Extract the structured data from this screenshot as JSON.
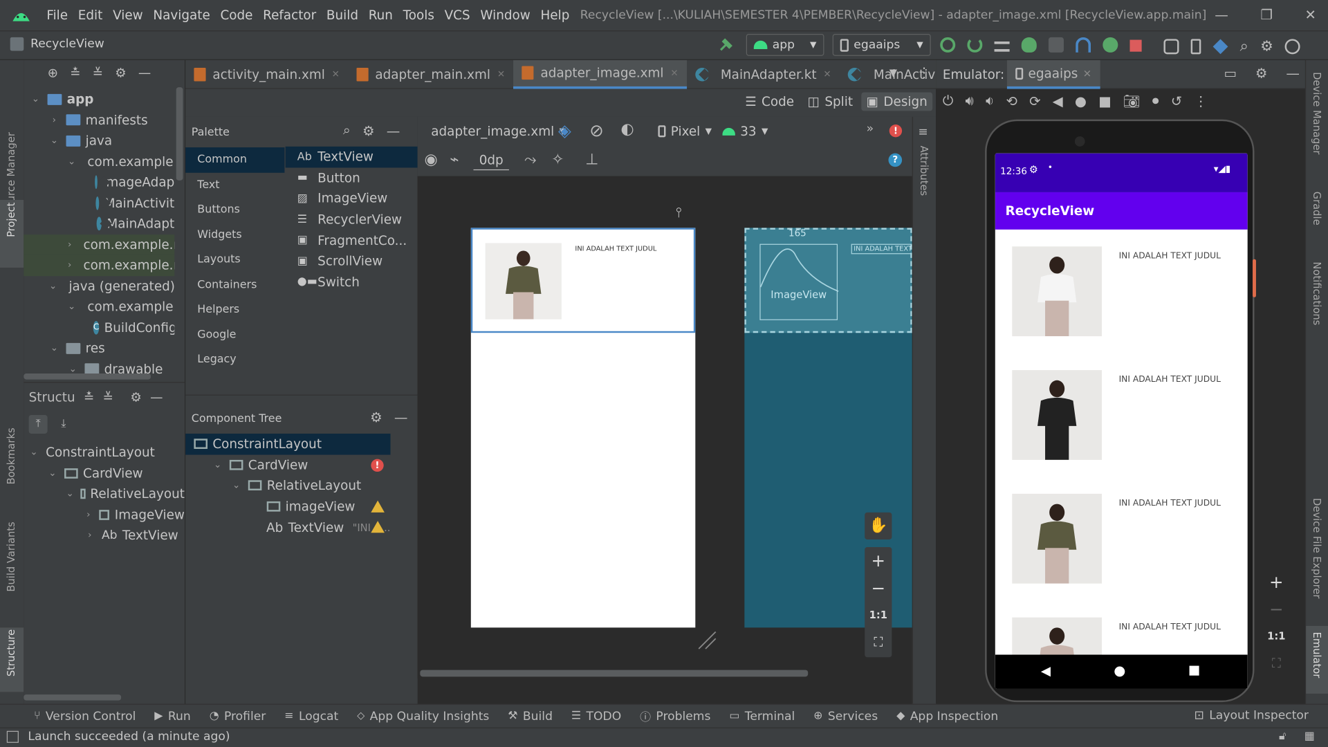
{
  "menu": [
    "File",
    "Edit",
    "View",
    "Navigate",
    "Code",
    "Refactor",
    "Build",
    "Run",
    "Tools",
    "VCS",
    "Window",
    "Help"
  ],
  "window_title": "RecycleView [...\\KULIAH\\SEMESTER 4\\PEMBER\\RecycleView] - adapter_image.xml [RecycleView.app.main]",
  "project_name": "RecycleView",
  "run_config": "app",
  "device_config": "egaaips",
  "left_strip": {
    "resource_manager": "Resource Manager",
    "project": "Project",
    "bookmarks": "Bookmarks",
    "build_variants": "Build Variants",
    "structure": "Structure"
  },
  "right_strip": {
    "device_manager": "Device Manager",
    "gradle": "Gradle",
    "notifications": "Notifications",
    "device_file_explorer": "Device File Explorer",
    "emulator": "Emulator"
  },
  "project_tree": [
    {
      "label": "app",
      "indent": 0,
      "chev": "v",
      "icon": "folder-blue",
      "bold": true
    },
    {
      "label": "manifests",
      "indent": 1,
      "chev": ">",
      "icon": "folder-blue"
    },
    {
      "label": "java",
      "indent": 1,
      "chev": "v",
      "icon": "folder-blue"
    },
    {
      "label": "com.example.r",
      "indent": 2,
      "chev": "v",
      "icon": "folder"
    },
    {
      "label": "ImageAdap",
      "indent": 3,
      "chev": "",
      "icon": "kotlin"
    },
    {
      "label": "MainActivit",
      "indent": 3,
      "chev": "",
      "icon": "kotlin"
    },
    {
      "label": "MainAdapt",
      "indent": 3,
      "chev": "",
      "icon": "kotlin"
    },
    {
      "label": "com.example.r",
      "indent": 2,
      "chev": ">",
      "icon": "folder",
      "hl": true
    },
    {
      "label": "com.example.r",
      "indent": 2,
      "chev": ">",
      "icon": "folder",
      "hl": true
    },
    {
      "label": "java (generated)",
      "indent": 1,
      "chev": "v",
      "icon": "folder"
    },
    {
      "label": "com.example.r",
      "indent": 2,
      "chev": "v",
      "icon": "folder"
    },
    {
      "label": "BuildConfig",
      "indent": 3,
      "chev": "",
      "icon": "class"
    },
    {
      "label": "res",
      "indent": 1,
      "chev": "v",
      "icon": "folder"
    },
    {
      "label": "drawable",
      "indent": 2,
      "chev": "v",
      "icon": "folder"
    }
  ],
  "structure_title": "Structu",
  "structure_tree": [
    {
      "label": "ConstraintLayout",
      "indent": 0,
      "chev": "v"
    },
    {
      "label": "CardView",
      "indent": 1,
      "chev": "v"
    },
    {
      "label": "RelativeLayout",
      "indent": 2,
      "chev": "v"
    },
    {
      "label": "ImageView",
      "indent": 3,
      "chev": ">"
    },
    {
      "label": "TextView",
      "indent": 3,
      "chev": ">",
      "prefix": "Ab"
    }
  ],
  "editor_tabs": [
    {
      "label": "activity_main.xml",
      "icon": "xml"
    },
    {
      "label": "adapter_main.xml",
      "icon": "xml"
    },
    {
      "label": "adapter_image.xml",
      "icon": "xml",
      "active": true
    },
    {
      "label": "MainAdapter.kt",
      "icon": "kotlin"
    },
    {
      "label": "MainActivity.k",
      "icon": "kotlin"
    }
  ],
  "view_modes": {
    "code": "Code",
    "split": "Split",
    "design": "Design"
  },
  "palette": {
    "title": "Palette",
    "categories": [
      "Common",
      "Text",
      "Buttons",
      "Widgets",
      "Layouts",
      "Containers",
      "Helpers",
      "Google",
      "Legacy"
    ],
    "items": [
      {
        "label": "TextView",
        "prefix": "Ab"
      },
      {
        "label": "Button"
      },
      {
        "label": "ImageView"
      },
      {
        "label": "RecyclerView"
      },
      {
        "label": "FragmentCo..."
      },
      {
        "label": "ScrollView"
      },
      {
        "label": "Switch"
      }
    ]
  },
  "design_toolbar": {
    "file": "adapter_image.xml",
    "device": "Pixel",
    "api": "33",
    "margin": "0dp"
  },
  "component_tree": {
    "title": "Component Tree",
    "items": [
      {
        "label": "ConstraintLayout",
        "indent": 0
      },
      {
        "label": "CardView",
        "indent": 1,
        "status": "error"
      },
      {
        "label": "RelativeLayout",
        "indent": 2
      },
      {
        "label": "imageView",
        "indent": 3,
        "status": "warning"
      },
      {
        "label": "TextView",
        "indent": 3,
        "prefix": "Ab",
        "hint": "\"INI A...",
        "status": "warning"
      }
    ]
  },
  "attributes_label": "Attributes",
  "preview": {
    "text": "INI ADALAH TEXT JUDUL",
    "blueprint_num": "165",
    "blueprint_label": "ImageView",
    "blueprint_text": "INI ADALAH TEXT"
  },
  "zoom_controls": {
    "fit": "1:1"
  },
  "emulator": {
    "title": "Emulator:",
    "device": "egaaips",
    "time": "12:36",
    "app_title": "RecycleView",
    "items": [
      "INI ADALAH TEXT JUDUL",
      "INI ADALAH TEXT JUDUL",
      "INI ADALAH TEXT JUDUL",
      "INI ADALAH TEXT JUDUL"
    ],
    "app_bar_color": "#6200ee",
    "status_bar_color": "#3700b3"
  },
  "bottom_tabs": [
    "Version Control",
    "Run",
    "Profiler",
    "Logcat",
    "App Quality Insights",
    "Build",
    "TODO",
    "Problems",
    "Terminal",
    "Services",
    "App Inspection"
  ],
  "layout_inspector": "Layout Inspector",
  "status_message": "Launch succeeded (a minute ago)",
  "colors": {
    "accent": "#4a88c7",
    "selection": "#0d293e",
    "warning": "#e2b43a",
    "error": "#e0504c",
    "blueprint": "#1f5d72"
  }
}
